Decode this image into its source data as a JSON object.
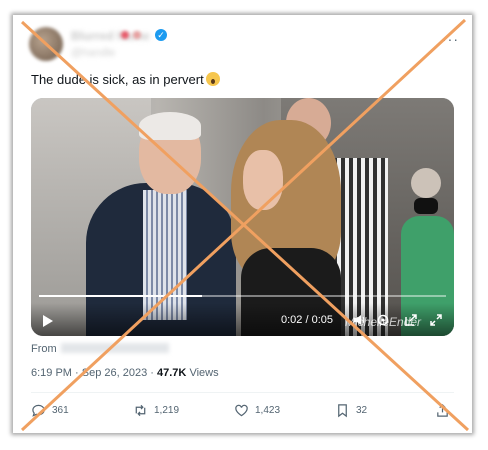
{
  "tweet": {
    "text": "The dude is sick, as in pervert",
    "verified_icon": "✓",
    "more_icon": "···"
  },
  "video": {
    "current_time": "0:02",
    "duration": "0:05",
    "separator": "/",
    "progress_fraction": 0.4,
    "watermark": "MichelleEnder"
  },
  "meta": {
    "from_label": "From",
    "time": "6:19 PM",
    "date": "Sep 26, 2023",
    "views_count": "47.7K",
    "views_label": "Views",
    "separator": "·"
  },
  "actions": {
    "replies": "361",
    "retweets": "1,219",
    "likes": "1,423",
    "bookmarks": "32"
  },
  "overlay": {
    "cross_color": "#f0a060"
  }
}
